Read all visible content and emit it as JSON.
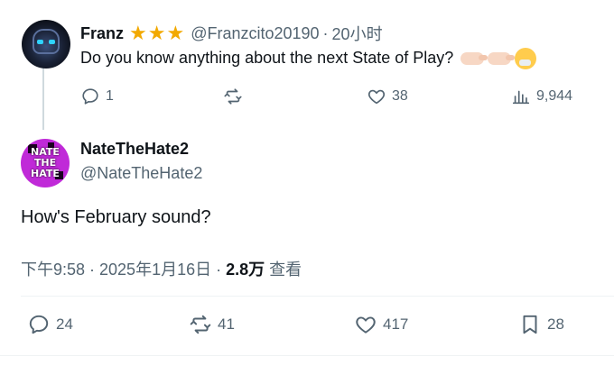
{
  "reply": {
    "name": "Franz",
    "stars": "★★★",
    "handle": "@Franzcito20190",
    "separator": "·",
    "time": "20小时",
    "text": "Do you know anything about the next State of Play?",
    "emojis": [
      "backhand-index-pointing-left",
      "backhand-index-pointing-right",
      "sneezing-face"
    ],
    "actions": {
      "replies": "1",
      "reposts": "",
      "likes": "38",
      "views": "9,944"
    }
  },
  "tweet": {
    "name": "NateTheHate2",
    "handle": "@NateTheHate2",
    "avatar_text": "NATE THE HATE",
    "text": "How's February sound?",
    "timestamp": "下午9:58 · 2025年1月16日 · ",
    "views_count": "2.8万",
    "views_label": " 查看",
    "actions": {
      "replies": "24",
      "reposts": "41",
      "likes": "417",
      "bookmarks": "28"
    }
  },
  "colors": {
    "text": "#0f1419",
    "secondary": "#536471",
    "star": "#f2a900",
    "divider": "#eff3f4",
    "thread": "#cfd9de",
    "avatar_nate": "#c02ad8"
  }
}
